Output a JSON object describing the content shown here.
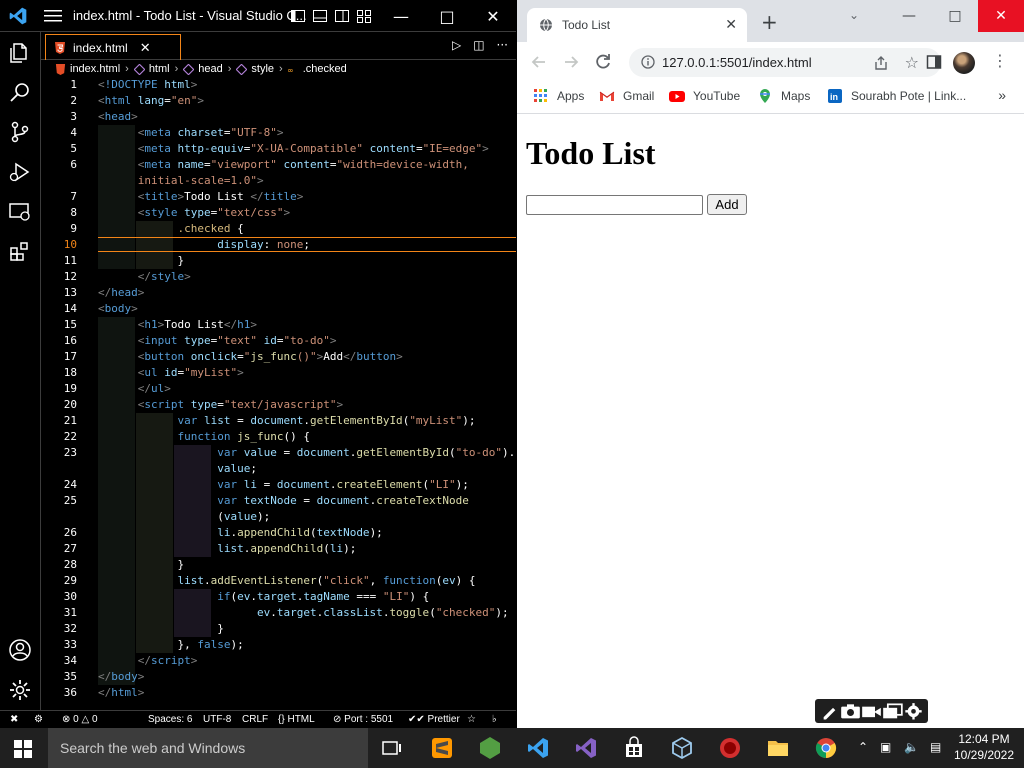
{
  "vscode": {
    "title": "index.html - Todo List - Visual Studio C...",
    "tab_label": "index.html",
    "breadcrumb": [
      "index.html",
      "html",
      "head",
      "style",
      ".checked"
    ],
    "status": {
      "errors": "0",
      "warnings": "0",
      "spaces": "Spaces: 6",
      "encoding": "UTF-8",
      "eol": "CRLF",
      "language": "HTML",
      "port": "Port : 5501",
      "prettier": "Prettier"
    },
    "line_numbers": [
      "1",
      "2",
      "3",
      "4",
      "5",
      "6",
      "",
      "7",
      "8",
      "9",
      "10",
      "11",
      "12",
      "13",
      "14",
      "15",
      "16",
      "17",
      "18",
      "19",
      "20",
      "21",
      "22",
      "23",
      "",
      "24",
      "25",
      "",
      "26",
      "27",
      "28",
      "29",
      "30",
      "31",
      "32",
      "33",
      "34",
      "35",
      "36"
    ]
  },
  "chrome": {
    "tab_title": "Todo List",
    "url": "127.0.0.1:5501/index.html",
    "bookmarks": [
      "Apps",
      "Gmail",
      "YouTube",
      "Maps",
      "Sourabh Pote | Link..."
    ],
    "page": {
      "heading": "Todo List",
      "input_value": "",
      "button_label": "Add"
    }
  },
  "taskbar": {
    "search_placeholder": "Search the web and Windows",
    "time": "12:04 PM",
    "date": "10/29/2022"
  },
  "colors": {
    "accent_border": "#f38518",
    "chrome_close": "#e81123",
    "tag": "#569cd6",
    "attr": "#9cdcfe",
    "string": "#ce9178",
    "function": "#dcdcaa"
  }
}
